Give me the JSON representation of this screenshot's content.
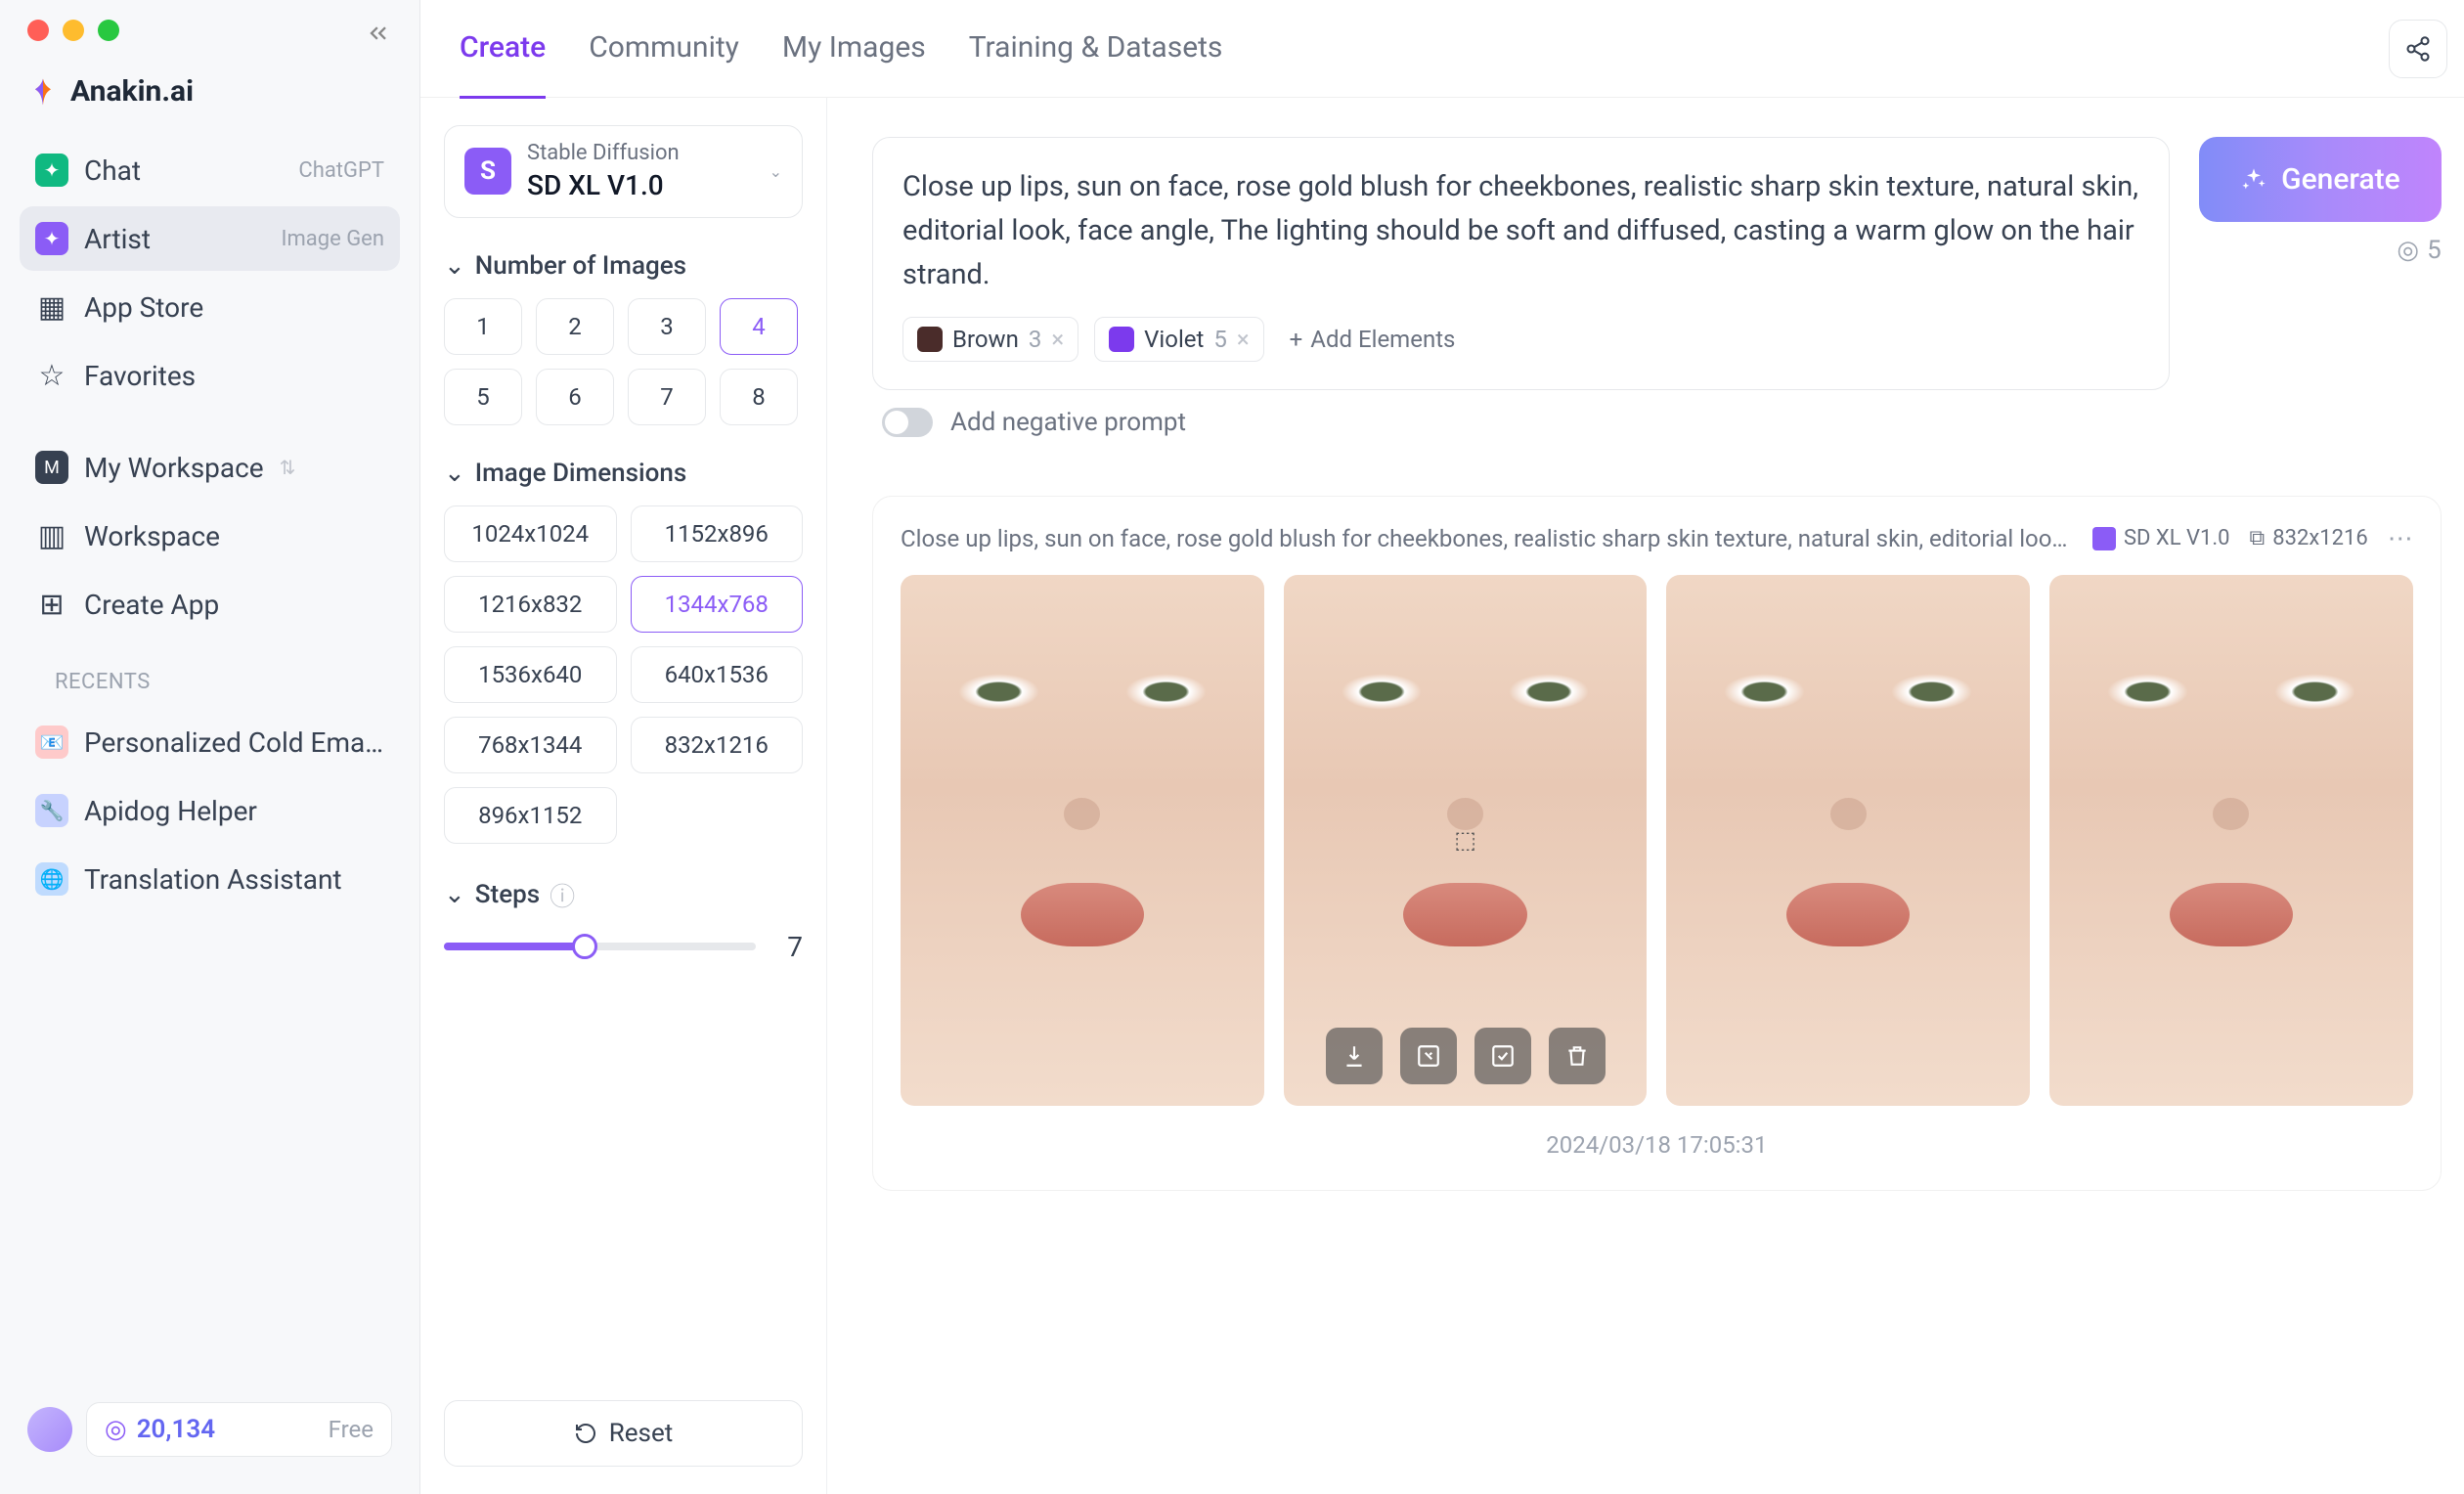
{
  "brand": {
    "name": "Anakin.ai"
  },
  "sidebar": {
    "items": [
      {
        "label": "Chat",
        "badge": "ChatGPT"
      },
      {
        "label": "Artist",
        "badge": "Image Gen"
      },
      {
        "label": "App Store"
      },
      {
        "label": "Favorites"
      },
      {
        "label": "My Workspace"
      },
      {
        "label": "Workspace"
      },
      {
        "label": "Create App"
      }
    ],
    "recents_label": "RECENTS",
    "recents": [
      {
        "label": "Personalized Cold Email Fro…"
      },
      {
        "label": "Apidog Helper"
      },
      {
        "label": "Translation Assistant"
      }
    ],
    "credits": "20,134",
    "plan": "Free"
  },
  "tabs": [
    "Create",
    "Community",
    "My Images",
    "Training & Datasets"
  ],
  "model": {
    "provider": "Stable Diffusion",
    "name": "SD XL V1.0"
  },
  "settings": {
    "num_images": {
      "label": "Number of Images",
      "options": [
        "1",
        "2",
        "3",
        "4",
        "5",
        "6",
        "7",
        "8"
      ],
      "selected": "4"
    },
    "dimensions": {
      "label": "Image Dimensions",
      "options": [
        "1024x1024",
        "1152x896",
        "1216x832",
        "1344x768",
        "1536x640",
        "640x1536",
        "768x1344",
        "832x1216",
        "896x1152"
      ],
      "selected": "1344x768"
    },
    "steps": {
      "label": "Steps",
      "value": "7"
    },
    "reset": "Reset"
  },
  "prompt": {
    "text": "Close up lips, sun on face, rose gold blush for cheekbones, realistic sharp skin texture, natural skin, editorial look, face angle, The lighting should be soft and diffused, casting a warm glow on the hair strand.",
    "elements": [
      {
        "name": "Brown",
        "weight": "3"
      },
      {
        "name": "Violet",
        "weight": "5"
      }
    ],
    "add_elements": "Add Elements",
    "negative_label": "Add negative prompt",
    "generate": "Generate",
    "cost": "5"
  },
  "result": {
    "prompt_echo": "Close up lips, sun on face, rose gold blush for cheekbones, realistic sharp skin texture, natural skin, editorial look, face…",
    "model": "SD XL V1.0",
    "dimensions": "832x1216",
    "timestamp": "2024/03/18 17:05:31"
  }
}
